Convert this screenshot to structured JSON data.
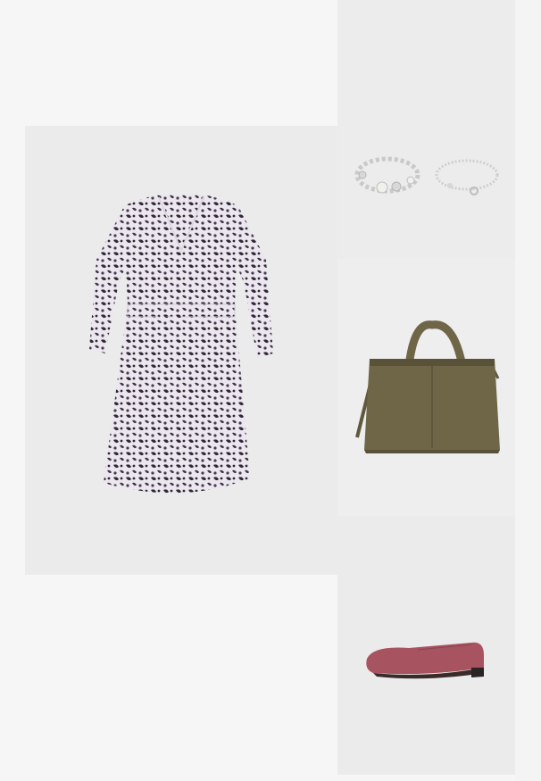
{
  "outfit": {
    "items": [
      {
        "id": "dress",
        "product": "floral-print-wrap-dress",
        "colors": {
          "base": "#ece6ee",
          "print": "#2f2838",
          "bg": "#ebebeb"
        }
      },
      {
        "id": "bracelets",
        "product": "silver-beaded-bracelets",
        "colors": {
          "metal": "#c9c9c9",
          "pearl": "#f2f0ec",
          "bg": "#ececec"
        }
      },
      {
        "id": "bag",
        "product": "suede-tote-bag",
        "colors": {
          "suede": "#6f6648",
          "shadow": "#5a5238",
          "bg": "#eeeeee"
        }
      },
      {
        "id": "shoe",
        "product": "leather-ballet-flat",
        "colors": {
          "leather": "#a85360",
          "sole": "#3a2a2a",
          "bg": "#ebebeb"
        }
      }
    ]
  }
}
